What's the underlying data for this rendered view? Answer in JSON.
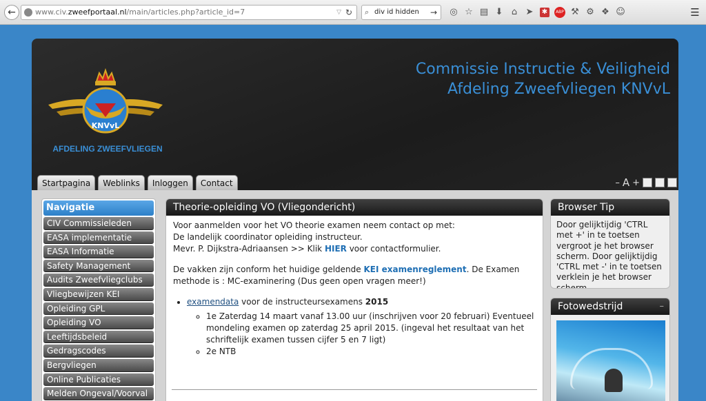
{
  "browser": {
    "url_prefix": "www.civ.",
    "url_domain": "zweefportaal.nl",
    "url_path": "/main/articles.php?article_id=7",
    "search_value": "div id hidden",
    "abp_label": "ABP"
  },
  "header": {
    "logo_text": "AFDELING ZWEEFVLIEGEN",
    "title_line1": "Commissie Instructie & Veiligheid",
    "title_line2": "Afdeling Zweefvliegen KNVvL",
    "logo_emblem_text": "KNVvL"
  },
  "tabs": [
    "Startpagina",
    "Weblinks",
    "Inloggen",
    "Contact"
  ],
  "font_controls": {
    "minus": "–",
    "a": "A",
    "plus": "+"
  },
  "navigation": {
    "title": "Navigatie",
    "items": [
      "CIV Commissieleden",
      "EASA implementatie",
      "EASA Informatie",
      "Safety Management",
      "Audits Zweefvliegclubs",
      "Vliegbewijzen KEI",
      "Opleiding GPL",
      "Opleiding VO",
      "Leeftijdsbeleid",
      "Gedragscodes",
      "Bergvliegen",
      "Online Publicaties",
      "Melden Ongeval/Voorval"
    ]
  },
  "article": {
    "title": "Theorie-opleiding VO (Vliegondericht)",
    "p1_line1": "Voor aanmelden voor het VO theorie examen neem contact op met:",
    "p1_line2": "De landelijk coordinator opleiding instructeur.",
    "p1_line3_pre": "Mevr. P. Dijkstra-Adriaansen >> Klik ",
    "p1_link": "HIER",
    "p1_line3_post": " voor contactformulier.",
    "p2_pre": "De vakken zijn conform het huidige geldende ",
    "p2_link": "KEI examenreglement",
    "p2_post": ". De Examen methode is : MC-examinering (Dus geen open vragen meer!)",
    "bullet_link": "examendata",
    "bullet_text": " voor de instructeursexamens ",
    "bullet_year": "2015",
    "sub1": "1e Zaterdag 14 maart vanaf 13.00 uur (inschrijven voor 20 februari) Eventueel mondeling examen op zaterdag 25 april   2015. (ingeval het resultaat van het schriftelijk examen tussen cijfer 5 en 7 ligt)",
    "sub2": "2e NTB"
  },
  "browser_tip": {
    "title": "Browser Tip",
    "text": "Door gelijktijdig 'CTRL met +' in te toetsen vergroot je het browser scherm. Door gelijktijdig 'CTRL met -' in te toetsen verklein je het browser scherm."
  },
  "photo_box": {
    "title": "Fotowedstrijd",
    "collapse": "–"
  }
}
